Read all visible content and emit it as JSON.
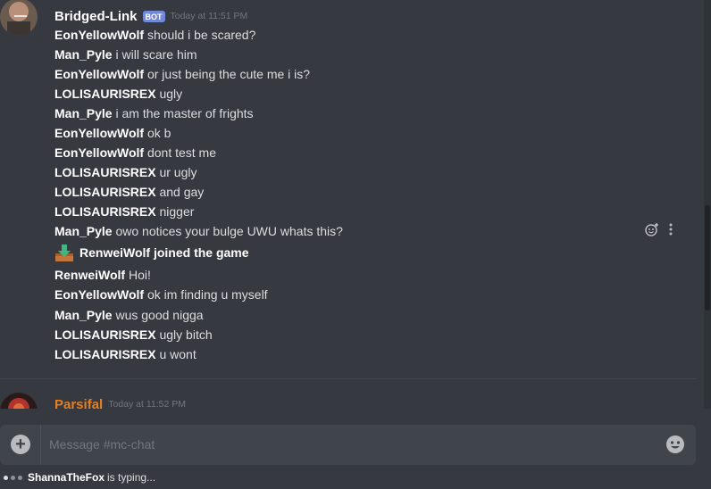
{
  "chat": {
    "group1": {
      "username": "Bridged-Link",
      "bot_tag": "BOT",
      "timestamp": "Today at 11:51 PM",
      "avatar": "user-avatar",
      "messages": [
        {
          "author": "EonYellowWolf",
          "text": "should i be scared?"
        },
        {
          "author": "Man_Pyle",
          "text": "i will scare him"
        },
        {
          "author": "EonYellowWolf",
          "text": "or just being the cute me i is?"
        },
        {
          "author": "LOLISAURISREX",
          "text": "ugly"
        },
        {
          "author": "Man_Pyle",
          "text": "i am the master of frights"
        },
        {
          "author": "EonYellowWolf",
          "text": "ok b"
        },
        {
          "author": "EonYellowWolf",
          "text": "dont test me"
        },
        {
          "author": "LOLISAURISREX",
          "text": "ur ugly"
        },
        {
          "author": "LOLISAURISREX",
          "text": "and gay"
        },
        {
          "author": "LOLISAURISREX",
          "text": "nigger"
        },
        {
          "author": "Man_Pyle",
          "text": "owo notices your bulge UWU whats this?"
        },
        {
          "join": "RenweiWolf joined the game",
          "icon": "join-game-icon"
        },
        {
          "author": "RenweiWolf",
          "text": "Hoi!"
        },
        {
          "author": "EonYellowWolf",
          "text": "ok im finding u myself"
        },
        {
          "author": "Man_Pyle",
          "text": "wus good nigga"
        },
        {
          "author": "LOLISAURISREX",
          "text": "ugly bitch"
        },
        {
          "author": "LOLISAURISREX",
          "text": "u wont"
        }
      ]
    },
    "group2": {
      "username": "Parsifal",
      "timestamp": "Today at 11:52 PM",
      "color": "#e67e22"
    },
    "hover_actions": [
      "add-reaction-icon",
      "more-options-icon"
    ]
  },
  "composer": {
    "placeholder": "Message #mc-chat",
    "add_icon": "plus-circle-icon",
    "emoji_icon": "emoji-icon"
  },
  "typing": {
    "user": "ShannaTheFox",
    "text": "is typing..."
  },
  "colors": {
    "background": "#36393f",
    "input": "#40444b",
    "bot_tag": "#7289da"
  }
}
